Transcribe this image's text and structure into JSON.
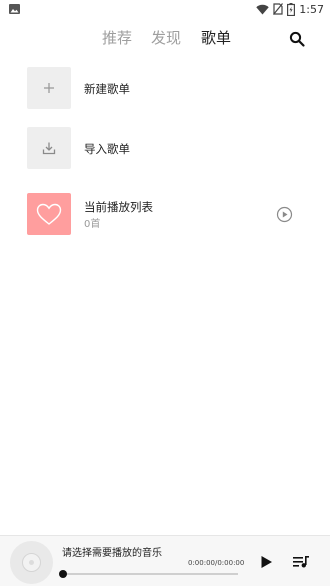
{
  "status_bar": {
    "time": "1:57",
    "icons": [
      "image-icon",
      "wifi-icon",
      "no-sim-icon",
      "battery-charging-icon"
    ]
  },
  "header": {
    "tabs": [
      {
        "label": "推荐",
        "active": false
      },
      {
        "label": "发现",
        "active": false
      },
      {
        "label": "歌单",
        "active": true
      }
    ],
    "search_icon": "search-icon"
  },
  "playlists": {
    "new_label": "新建歌单",
    "import_label": "导入歌单",
    "current": {
      "label": "当前播放列表",
      "count": "0首"
    }
  },
  "player": {
    "title": "请选择需要播放的音乐",
    "time": "0:00:00/0:00:00",
    "progress": 0
  },
  "colors": {
    "accent_pink": "#ff9e9e",
    "tile_gray": "#eeeeee",
    "inactive_tab": "#9e9e9e"
  }
}
